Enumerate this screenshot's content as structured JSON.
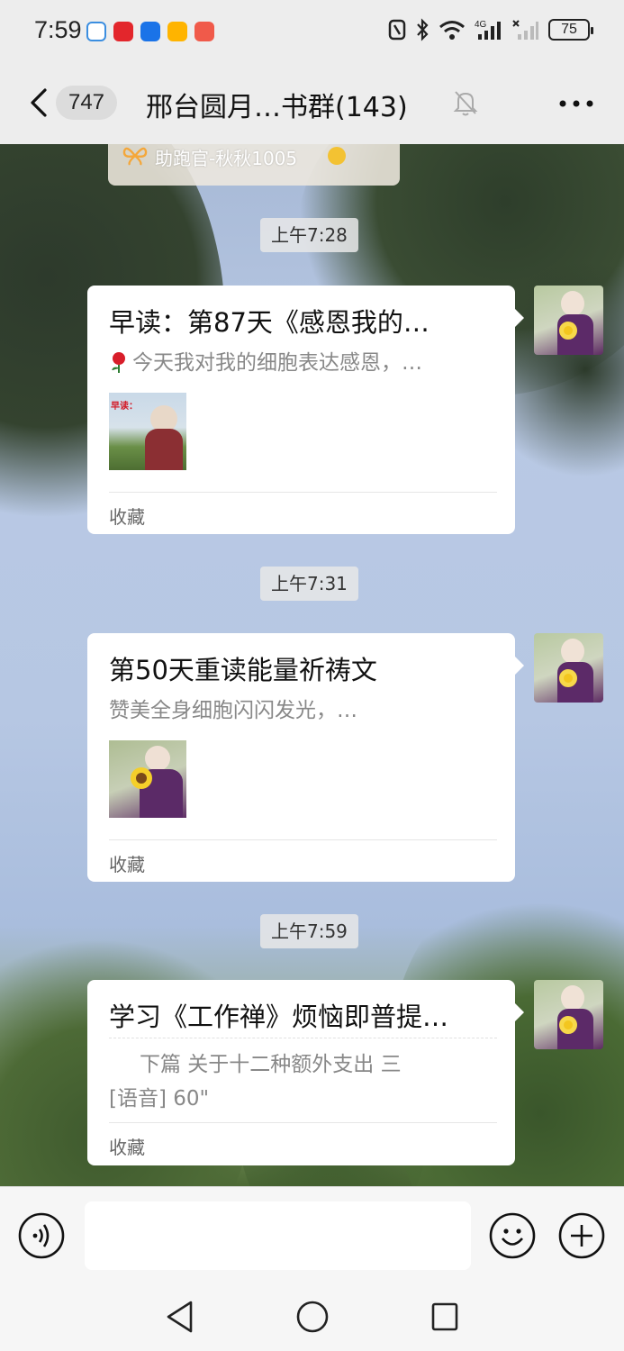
{
  "status_bar": {
    "time": "7:59",
    "battery": "75",
    "network": "4G"
  },
  "nav": {
    "unread_count": "747",
    "title": "邢台圆月…书群(143)"
  },
  "prev_message": {
    "sender": "助跑官-秋秋1005"
  },
  "messages": [
    {
      "time": "上午7:28",
      "title": "早读：第87天《感恩我的…",
      "desc": "今天我对我的细胞表达感恩，…",
      "thumb_caption": "早读：",
      "source": "收藏"
    },
    {
      "time": "上午7:31",
      "title": "第50天重读能量祈祷文",
      "desc": "赞美全身细胞闪闪发光，…",
      "source": "收藏"
    },
    {
      "time": "上午7:59",
      "title": "学习《工作禅》烦恼即普提…",
      "desc": "下篇 关于十二种额外支出  三",
      "voice": "[语音] 60\"",
      "source": "收藏"
    }
  ],
  "colors": {
    "background": "#ededed",
    "bubble": "#ffffff",
    "verified": "#f3c232"
  }
}
